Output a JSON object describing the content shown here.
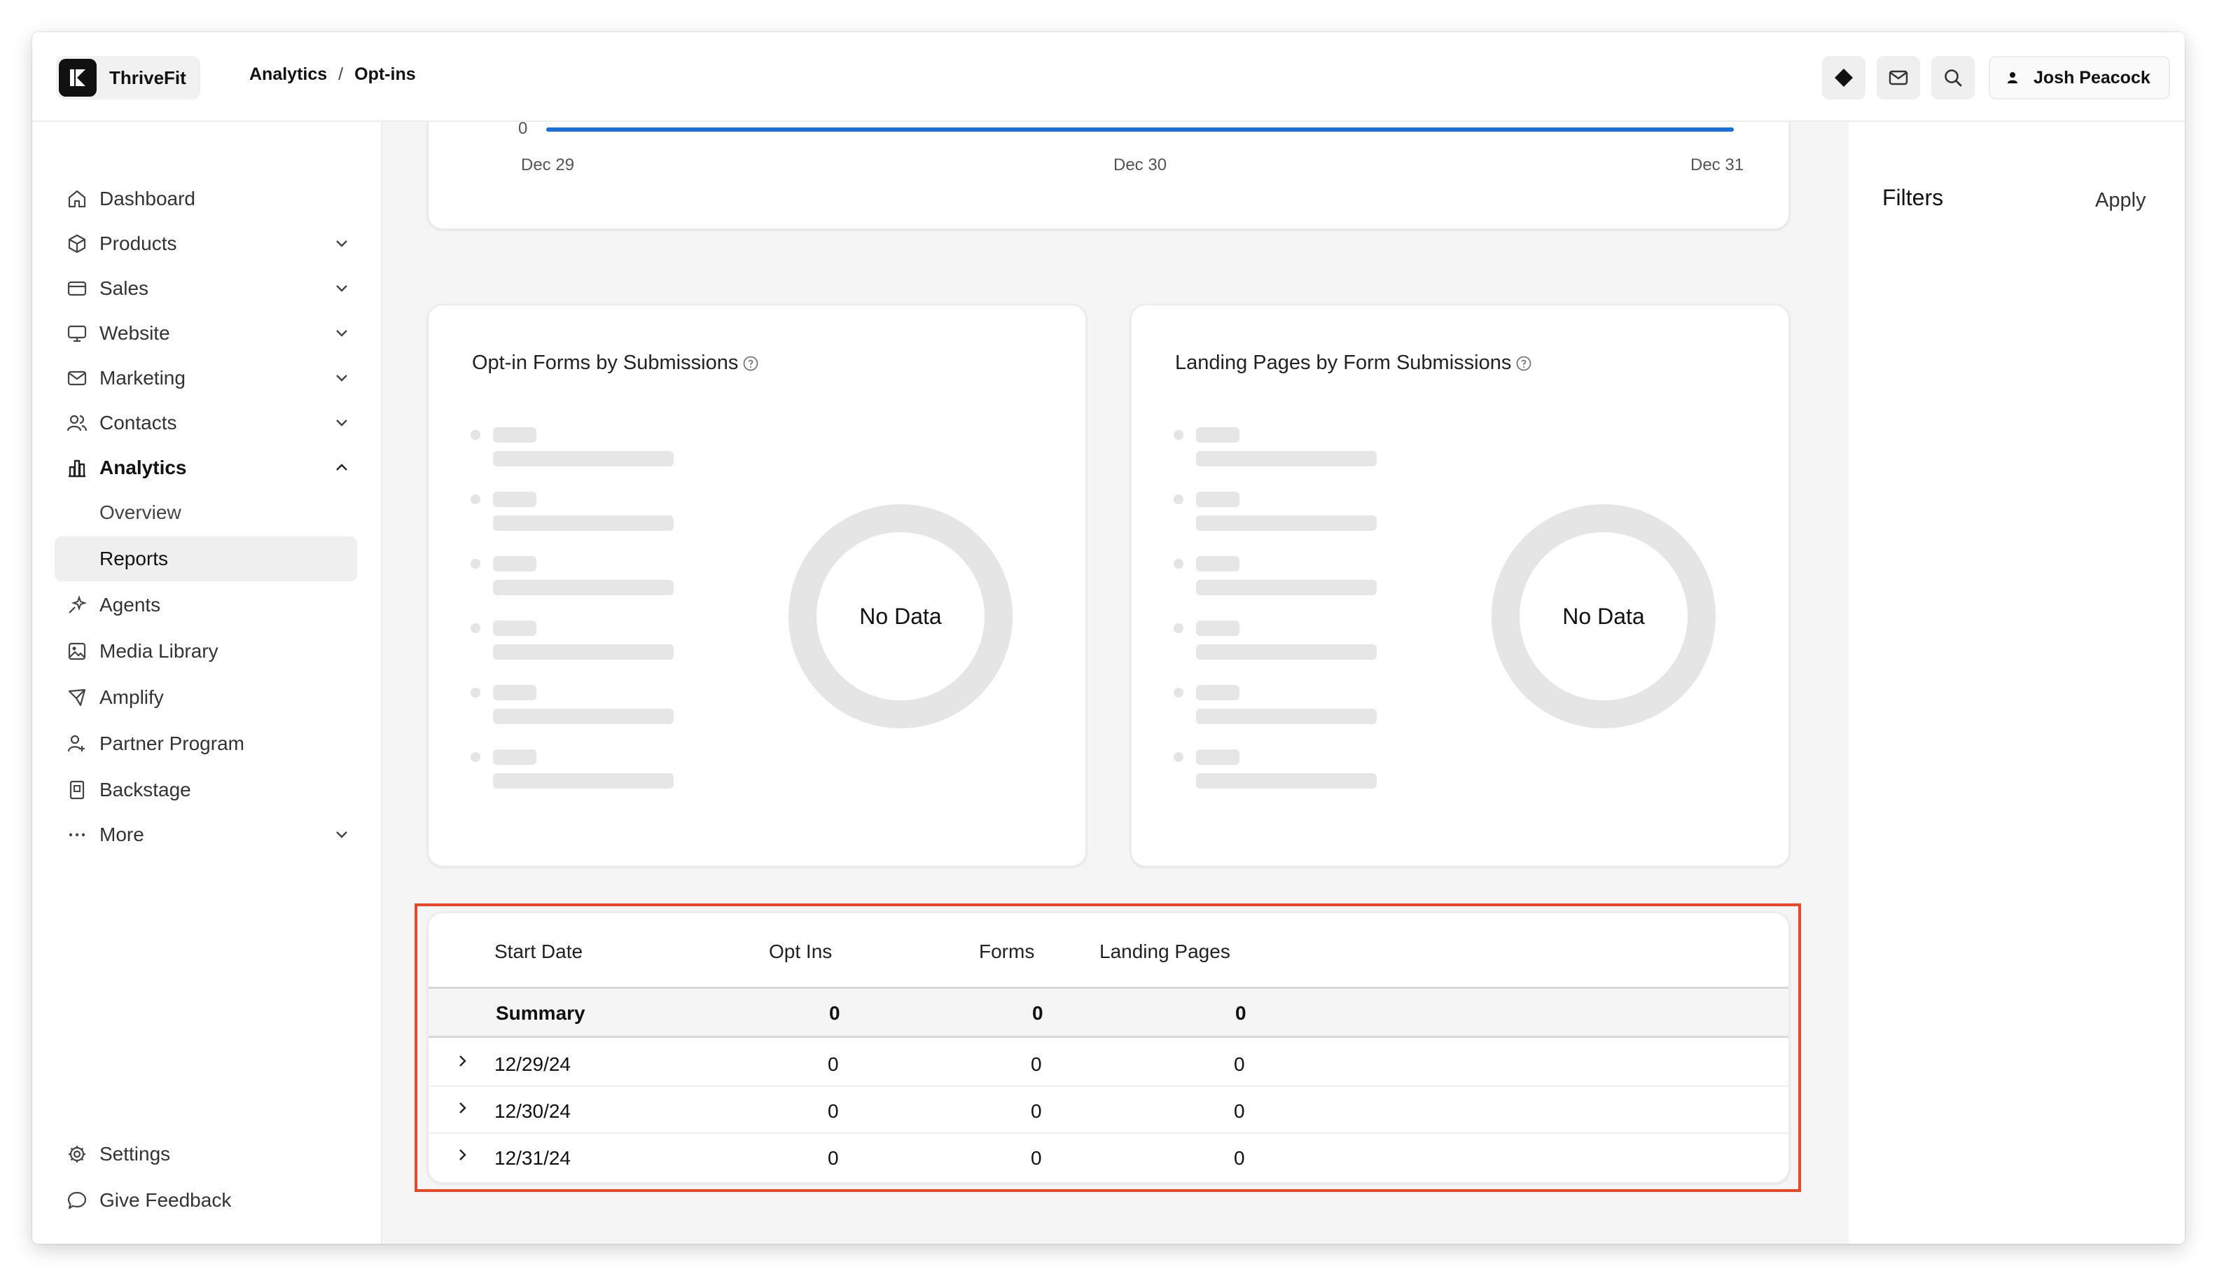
{
  "app": {
    "brand_name": "ThriveFit",
    "breadcrumb": {
      "section": "Analytics",
      "separator": "/",
      "page": "Opt-ins"
    },
    "user_name": "Josh Peacock"
  },
  "sidebar": {
    "items": [
      {
        "label": "Dashboard"
      },
      {
        "label": "Products"
      },
      {
        "label": "Sales"
      },
      {
        "label": "Website"
      },
      {
        "label": "Marketing"
      },
      {
        "label": "Contacts"
      },
      {
        "label": "Analytics"
      },
      {
        "label": "Agents"
      },
      {
        "label": "Media Library"
      },
      {
        "label": "Amplify"
      },
      {
        "label": "Partner Program"
      },
      {
        "label": "Backstage"
      },
      {
        "label": "More"
      }
    ],
    "analytics_sub": [
      {
        "label": "Overview"
      },
      {
        "label": "Reports"
      }
    ],
    "bottom": [
      {
        "label": "Settings"
      },
      {
        "label": "Give Feedback"
      }
    ]
  },
  "chart": {
    "y_zero_label": "0",
    "x_ticks": [
      "Dec 29",
      "Dec 30",
      "Dec 31"
    ]
  },
  "chart_data": {
    "type": "line",
    "x": [
      "Dec 29",
      "Dec 30",
      "Dec 31"
    ],
    "series": [
      {
        "values": [
          0,
          0,
          0
        ]
      }
    ],
    "accent": "#1a6fd6"
  },
  "donuts": [
    {
      "title": "Opt-in Forms by Submissions",
      "empty_label": "No Data"
    },
    {
      "title": "Landing Pages by Form Submissions",
      "empty_label": "No Data"
    }
  ],
  "filters": {
    "title": "Filters",
    "apply_label": "Apply"
  },
  "table": {
    "headers": [
      "Start Date",
      "Opt Ins",
      "Forms",
      "Landing Pages"
    ],
    "summary": {
      "label": "Summary",
      "opt_ins": "0",
      "forms": "0",
      "landing_pages": "0"
    },
    "rows": [
      {
        "date": "12/29/24",
        "opt_ins": "0",
        "forms": "0",
        "landing_pages": "0"
      },
      {
        "date": "12/30/24",
        "opt_ins": "0",
        "forms": "0",
        "landing_pages": "0"
      },
      {
        "date": "12/31/24",
        "opt_ins": "0",
        "forms": "0",
        "landing_pages": "0"
      }
    ],
    "highlight_color": "#e8472a"
  }
}
